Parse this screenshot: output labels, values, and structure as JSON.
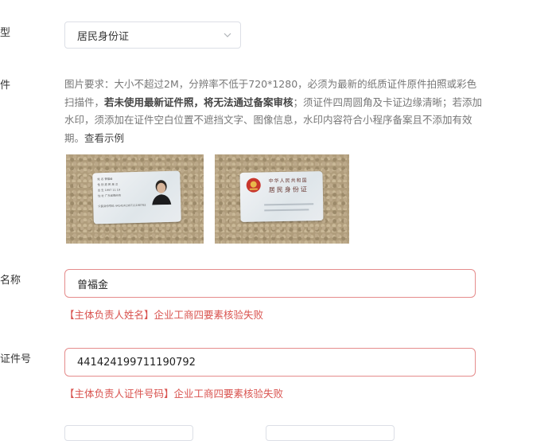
{
  "type_field": {
    "label": "型",
    "value": "居民身份证"
  },
  "cert_field": {
    "label": "件",
    "requirement_part1": "图片要求：大小不超过2M，分辨率不低于720*1280，必须为最新的纸质证件原件拍照或彩色扫描件，",
    "requirement_bold": "若未使用最新证件照，将无法通过备案审核",
    "requirement_part2": "；须证件四周圆角及卡证边缘清晰；若添加水印，须添加在证件空白位置不遮挡文字、图像信息，水印内容符合小程序备案且不添加有效期。",
    "example_link": "查看示例",
    "front_card": {
      "lines": [
        "姓 名 曾福金",
        "性 别 男  民 族 汉",
        "出 生 1997 11 19",
        "住 址 广东省梅州市",
        "公民身份号码 441424199711190792"
      ]
    },
    "back_card": {
      "title_line1": "中华人民共和国",
      "title_line2": "居民身份证"
    }
  },
  "name_field": {
    "label": "名称",
    "value": "曾福金",
    "error": "【主体负责人姓名】企业工商四要素核验失败"
  },
  "id_field": {
    "label": "证件号",
    "value": "441424199711190792",
    "error": "【主体负责人证件号码】企业工商四要素核验失败"
  },
  "colors": {
    "error": "#d9534f",
    "error_border": "#e58c8c",
    "border": "#dcdfe6"
  }
}
